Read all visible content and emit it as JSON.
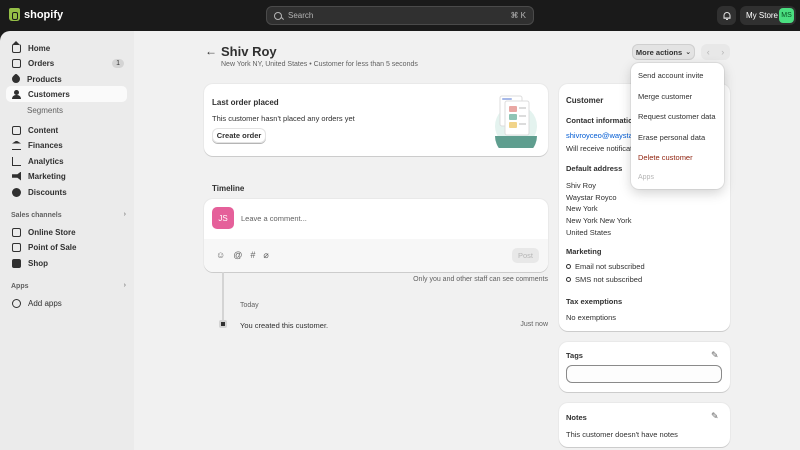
{
  "topbar": {
    "logo_text": "shopify",
    "search_placeholder": "Search",
    "search_shortcut": "⌘ K",
    "store_name": "My Store",
    "store_initials": "MS"
  },
  "sidebar": {
    "items": [
      {
        "label": "Home",
        "icon": "home-icon"
      },
      {
        "label": "Orders",
        "icon": "orders-icon",
        "badge": "1"
      },
      {
        "label": "Products",
        "icon": "tag-icon"
      },
      {
        "label": "Customers",
        "icon": "person-icon"
      },
      {
        "label": "Segments"
      },
      {
        "label": "Content",
        "icon": "content-icon"
      },
      {
        "label": "Finances",
        "icon": "bank-icon"
      },
      {
        "label": "Analytics",
        "icon": "chart-icon"
      },
      {
        "label": "Marketing",
        "icon": "megaphone-icon"
      },
      {
        "label": "Discounts",
        "icon": "discount-icon"
      }
    ],
    "sales_channels_title": "Sales channels",
    "channels": [
      {
        "label": "Online Store",
        "icon": "online-store-icon"
      },
      {
        "label": "Point of Sale",
        "icon": "pos-icon"
      },
      {
        "label": "Shop",
        "icon": "shop-icon"
      }
    ],
    "apps_title": "Apps",
    "add_apps": "Add apps"
  },
  "header": {
    "name": "Shiv Roy",
    "subtitle": "New York NY, United States • Customer for less than 5 seconds",
    "more_actions": "More actions"
  },
  "more_actions_menu": {
    "items": [
      "Send account invite",
      "Merge customer",
      "Request customer data",
      "Erase personal data",
      "Delete customer",
      "Apps"
    ],
    "danger_color": "#8e1f0b"
  },
  "last_order": {
    "title": "Last order placed",
    "text": "This customer hasn't placed any orders yet",
    "button": "Create order"
  },
  "timeline": {
    "title": "Timeline",
    "avatar": "JS",
    "comment_placeholder": "Leave a comment...",
    "post_button": "Post",
    "note": "Only you and other staff can see comments",
    "date_label": "Today",
    "event_text": "You created this customer.",
    "event_time": "Just now"
  },
  "customer_card": {
    "title": "Customer",
    "contact_title": "Contact information",
    "email": "shivroyceo@waystar",
    "notifications": "Will receive notifications",
    "address_title": "Default address",
    "address_lines": [
      "Shiv Roy",
      "Waystar Royco",
      "New York",
      "New York New York",
      "United States"
    ],
    "marketing_title": "Marketing",
    "email_marketing": "Email not subscribed",
    "sms_marketing": "SMS not subscribed",
    "tax_title": "Tax exemptions",
    "tax_value": "No exemptions"
  },
  "tags_card": {
    "title": "Tags"
  },
  "notes_card": {
    "title": "Notes",
    "text": "This customer doesn't have notes"
  },
  "colors": {
    "avatar_pink": "#e5609a",
    "link_blue": "#005bd3",
    "store_green": "#4ade80"
  }
}
